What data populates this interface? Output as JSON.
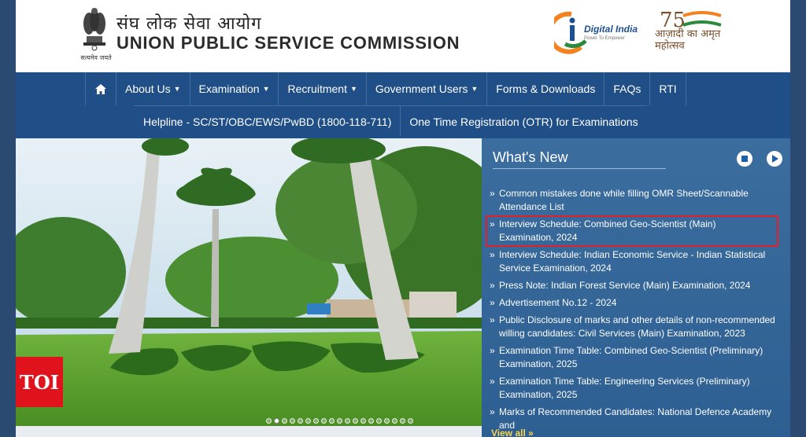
{
  "header": {
    "hindi_name": "संघ लोक सेवा आयोग",
    "english_name": "UNION PUBLIC SERVICE COMMISSION",
    "emblem_caption": "सत्यमेव जयते",
    "digital_india": "Digital India",
    "digital_india_sub": "Power To Empower",
    "amrit_text": "आज़ादी का अमृत महोत्सव"
  },
  "nav": {
    "row1": [
      {
        "label": "About Us",
        "dropdown": true
      },
      {
        "label": "Examination",
        "dropdown": true
      },
      {
        "label": "Recruitment",
        "dropdown": true
      },
      {
        "label": "Government Users",
        "dropdown": true
      },
      {
        "label": "Forms & Downloads",
        "dropdown": false
      },
      {
        "label": "FAQs",
        "dropdown": false
      },
      {
        "label": "RTI",
        "dropdown": false
      }
    ],
    "row2": [
      {
        "label": "Helpline - SC/ST/OBC/EWS/PwBD (1800-118-711)"
      },
      {
        "label": "One Time Registration (OTR) for Examinations"
      }
    ]
  },
  "hero": {
    "badge": "TOI",
    "slide_count": 19,
    "active_slide": 1
  },
  "news": {
    "title": "What's New",
    "items": [
      "Common mistakes done while filling OMR Sheet/Scannable Attendance List",
      "Interview Schedule: Combined Geo-Scientist (Main) Examination, 2024",
      "Interview Schedule: Indian Economic Service - Indian Statistical Service Examination, 2024",
      "Press Note: Indian Forest Service (Main) Examination, 2024",
      "Advertisement No.12 - 2024",
      "Public Disclosure of marks and other details of non-recommended willing candidates: Civil Services (Main) Examination, 2023",
      "Examination Time Table: Combined Geo-Scientist (Preliminary) Examination, 2025",
      "Examination Time Table: Engineering Services (Preliminary) Examination, 2025",
      "Marks of Recommended Candidates: National Defence Academy and"
    ],
    "highlighted_index": 1,
    "view_all": "View all »"
  },
  "colors": {
    "nav_bg": "#1f4f86",
    "news_bg": "#3b6d9f",
    "highlight": "#e32027",
    "toi_red": "#e0121b"
  }
}
